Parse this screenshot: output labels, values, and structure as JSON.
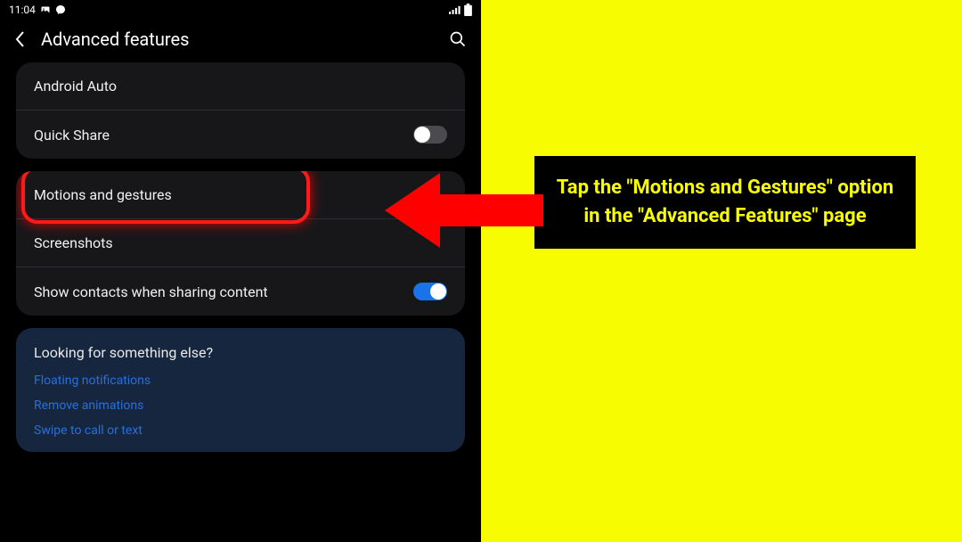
{
  "statusBar": {
    "time": "11:04"
  },
  "header": {
    "title": "Advanced features"
  },
  "card1": {
    "items": [
      {
        "label": "Android Auto"
      },
      {
        "label": "Quick Share"
      }
    ]
  },
  "card2": {
    "items": [
      {
        "label": "Motions and gestures"
      },
      {
        "label": "Screenshots"
      },
      {
        "label": "Show contacts when sharing content"
      }
    ]
  },
  "blueCard": {
    "title": "Looking for something else?",
    "links": [
      "Floating notifications",
      "Remove animations",
      "Swipe to call or text"
    ]
  },
  "instruction": {
    "text": "Tap the \"Motions and Gestures\" option in the \"Advanced Features\" page"
  }
}
